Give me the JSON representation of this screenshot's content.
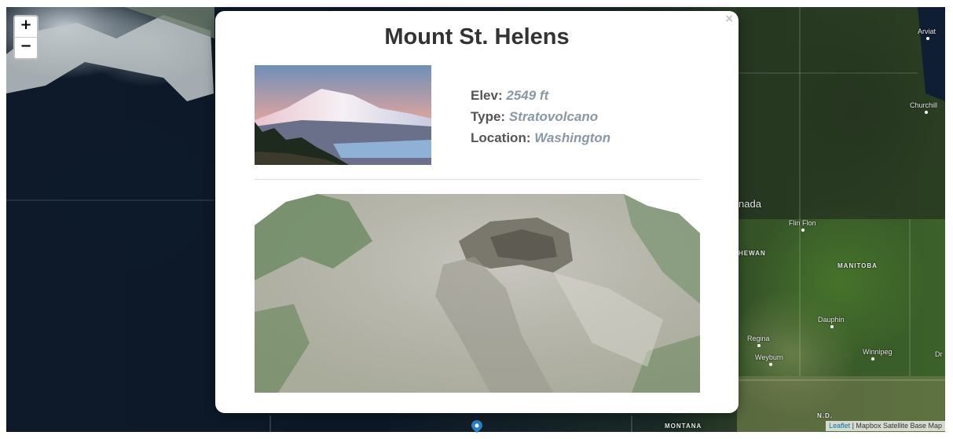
{
  "map": {
    "zoom_in": "+",
    "zoom_out": "−",
    "attribution_link": "Leaflet",
    "attribution_text": " | Mapbox Satellite Base Map",
    "labels": {
      "arviat": "Arviat",
      "churchill": "Churchill",
      "canada": "nada",
      "flin_flon": "Flin Flon",
      "saskatchewan": "HEWAN",
      "manitoba": "MANITOBA",
      "dauphin": "Dauphin",
      "regina": "Regina",
      "weyburn": "Weyburn",
      "winnipeg": "Winnipeg",
      "dr": "Dr",
      "nd": "N.D.",
      "montana": "MONTANA"
    }
  },
  "popup": {
    "close": "×",
    "title": "Mount St. Helens",
    "elev_label": "Elev:",
    "elev_value": "2549 ft",
    "type_label": "Type:",
    "type_value": "Stratovolcano",
    "location_label": "Location:",
    "location_value": "Washington"
  }
}
